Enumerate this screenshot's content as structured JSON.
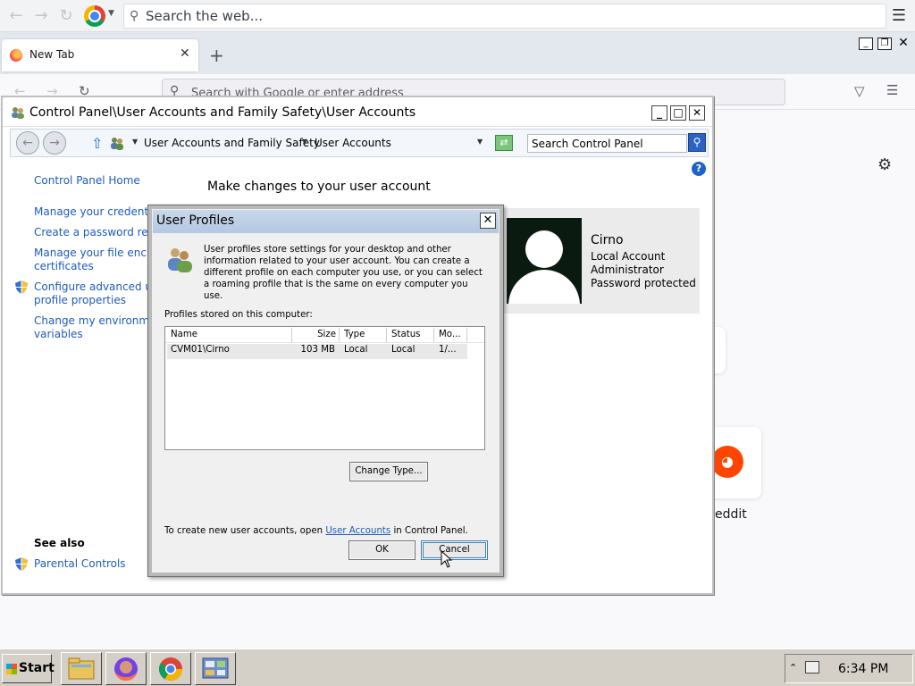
{
  "chrome": {
    "omnibox_placeholder": "Search the web..."
  },
  "firefox": {
    "tab_title": "New Tab",
    "new_tab_label": "+",
    "urlbar_placeholder": "Search with Google or enter address",
    "shortcut_label": "eddit"
  },
  "control_panel": {
    "title": "Control Panel\\User Accounts and Family Safety\\User Accounts",
    "breadcrumb": [
      "User Accounts and Family Safety",
      "User Accounts"
    ],
    "search_placeholder": "Search Control Panel",
    "sidebar": {
      "home": "Control Panel Home",
      "links": [
        "Manage your credentials",
        "Create a password reset disk",
        "Manage your file encryption certificates",
        "Configure advanced user profile properties",
        "Change my environment variables"
      ],
      "link_lines": [
        [
          "Manage your credentials"
        ],
        [
          "Create a password reset"
        ],
        [
          "Manage your file encryp",
          "certificates"
        ],
        [
          "Configure advanced use",
          "profile properties"
        ],
        [
          "Change my environmen",
          "variables"
        ]
      ],
      "see_also": "See also",
      "parental_controls": "Parental Controls"
    },
    "heading": "Make changes to your user account",
    "user": {
      "name": "Cirno",
      "lines": [
        "Local Account",
        "Administrator",
        "Password protected"
      ]
    }
  },
  "dialog": {
    "title": "User Profiles",
    "close": "✕",
    "description": "User profiles store settings for your desktop and other information related to your user account. You can create a different profile on each computer you use, or you can select a roaming profile that is the same on every computer you use.",
    "profiles_label": "Profiles stored on this computer:",
    "columns": [
      "Name",
      "Size",
      "Type",
      "Status",
      "Mo..."
    ],
    "rows": [
      {
        "name": "CVM01\\Cirno",
        "size": "103 MB",
        "type": "Local",
        "status": "Local",
        "modified": "1/..."
      }
    ],
    "change_type_button": "Change Type...",
    "footer_prefix": "To create new user accounts, open ",
    "footer_link": "User Accounts",
    "footer_suffix": " in Control Panel.",
    "ok_button": "OK",
    "cancel_button": "Cancel"
  },
  "taskbar": {
    "start_label": "Start",
    "apps": [
      "file-explorer-icon",
      "firefox-icon",
      "chrome-icon",
      "control-panel-icon"
    ],
    "clock": "6:34 PM"
  }
}
